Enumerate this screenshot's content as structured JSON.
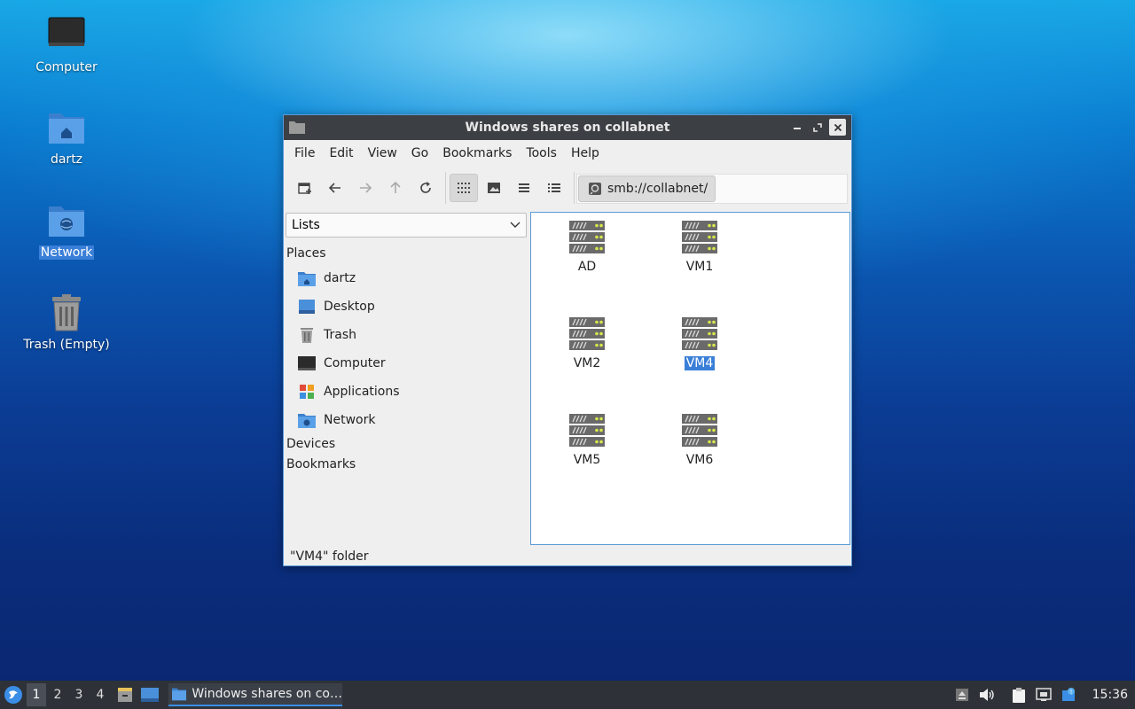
{
  "desktop": {
    "icons": [
      {
        "label": "Computer",
        "icon": "monitor-icon"
      },
      {
        "label": "dartz",
        "icon": "home-folder-icon"
      },
      {
        "label": "Network",
        "icon": "network-folder-icon"
      },
      {
        "label": "Trash (Empty)",
        "icon": "trash-icon"
      }
    ]
  },
  "window": {
    "title": "Windows shares on collabnet",
    "menu": [
      "File",
      "Edit",
      "View",
      "Go",
      "Bookmarks",
      "Tools",
      "Help"
    ],
    "location": "smb://collabnet/",
    "sidepane": {
      "selector": "Lists",
      "places_header": "Places",
      "places": [
        {
          "label": "dartz",
          "icon": "home-folder-icon"
        },
        {
          "label": "Desktop",
          "icon": "desktop-icon"
        },
        {
          "label": "Trash",
          "icon": "trash-icon"
        },
        {
          "label": "Computer",
          "icon": "monitor-icon"
        },
        {
          "label": "Applications",
          "icon": "applications-icon"
        },
        {
          "label": "Network",
          "icon": "network-folder-icon"
        }
      ],
      "devices_header": "Devices",
      "bookmarks_header": "Bookmarks"
    },
    "items": [
      {
        "label": "AD",
        "selected": false
      },
      {
        "label": "VM1",
        "selected": false
      },
      {
        "label": "VM2",
        "selected": false
      },
      {
        "label": "VM4",
        "selected": true
      },
      {
        "label": "VM5",
        "selected": false
      },
      {
        "label": "VM6",
        "selected": false
      }
    ],
    "status": "\"VM4\" folder"
  },
  "taskbar": {
    "workspaces": [
      "1",
      "2",
      "3",
      "4"
    ],
    "active_workspace": "1",
    "task_label": "Windows shares on co…",
    "clock": "15:36"
  },
  "colors": {
    "selection": "#3a7fd8",
    "titlebar": "#3c3f43",
    "taskbar": "#2e3238",
    "folder_blue": "#4a8fd9"
  }
}
